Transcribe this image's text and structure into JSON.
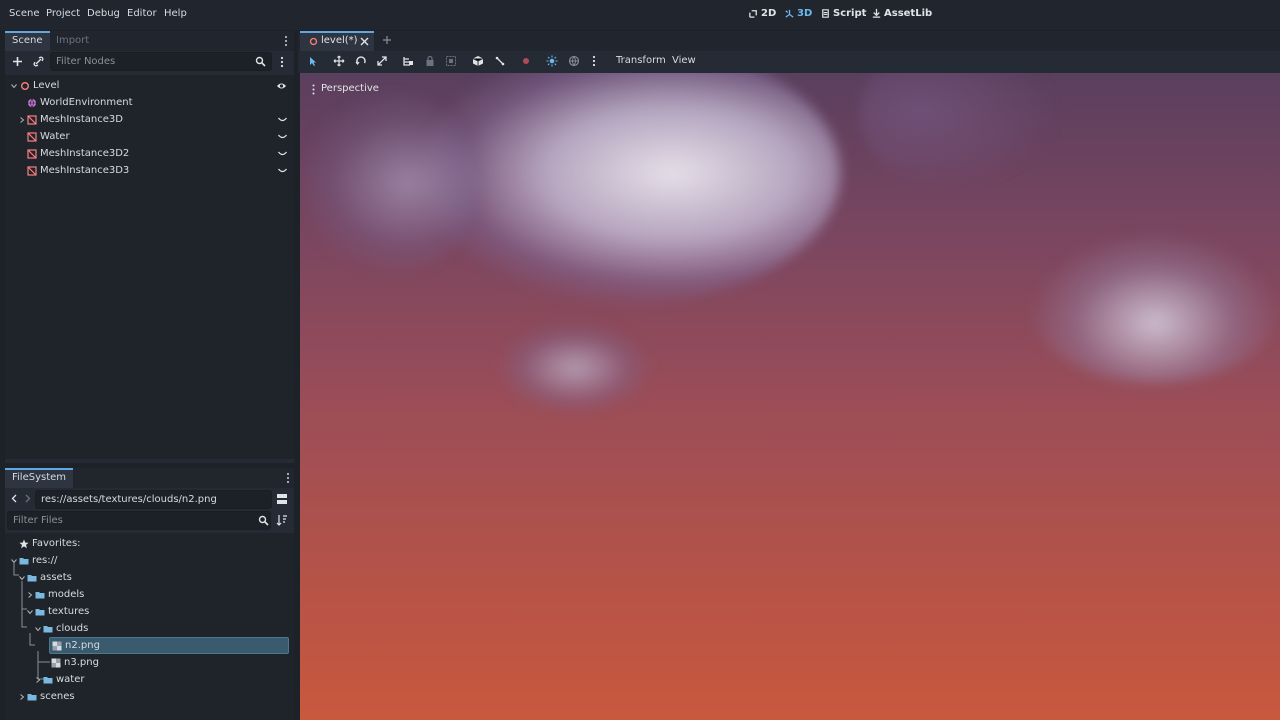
{
  "menu": {
    "items": [
      "Scene",
      "Project",
      "Debug",
      "Editor",
      "Help"
    ],
    "workspaces": [
      {
        "label": "2D",
        "active": false
      },
      {
        "label": "3D",
        "active": true
      },
      {
        "label": "Script",
        "active": false
      },
      {
        "label": "AssetLib",
        "active": false
      }
    ]
  },
  "scene_dock": {
    "tabs": [
      "Scene",
      "Import"
    ],
    "filter_placeholder": "Filter Nodes",
    "nodes": [
      {
        "label": "Level",
        "icon": "node3d-icon"
      },
      {
        "label": "WorldEnvironment",
        "icon": "world-environment-icon"
      },
      {
        "label": "MeshInstance3D",
        "icon": "mesh-instance-icon"
      },
      {
        "label": "Water",
        "icon": "mesh-instance-icon"
      },
      {
        "label": "MeshInstance3D2",
        "icon": "mesh-instance-icon"
      },
      {
        "label": "MeshInstance3D3",
        "icon": "mesh-instance-icon"
      }
    ]
  },
  "filesystem_dock": {
    "tab": "FileSystem",
    "path": "res://assets/textures/clouds/n2.png",
    "filter_placeholder": "Filter Files",
    "favorites": "Favorites:",
    "tree": [
      {
        "label": "res://",
        "type": "folder"
      },
      {
        "label": "assets",
        "type": "folder"
      },
      {
        "label": "models",
        "type": "folder"
      },
      {
        "label": "textures",
        "type": "folder"
      },
      {
        "label": "clouds",
        "type": "folder"
      },
      {
        "label": "n2.png",
        "type": "image",
        "selected": true
      },
      {
        "label": "n3.png",
        "type": "image"
      },
      {
        "label": "water",
        "type": "folder"
      },
      {
        "label": "scenes",
        "type": "folder"
      }
    ]
  },
  "editor": {
    "scene_tab": "level(*)",
    "toolbar_menus": [
      "Transform",
      "View"
    ],
    "viewport_label": "Perspective"
  },
  "colors": {
    "accent": "#5fa8e3",
    "folder": "#7ab8e0",
    "node_red": "#fc7f7f",
    "sky_top": "#5a3f5e",
    "sky_bottom": "#c9583e"
  }
}
